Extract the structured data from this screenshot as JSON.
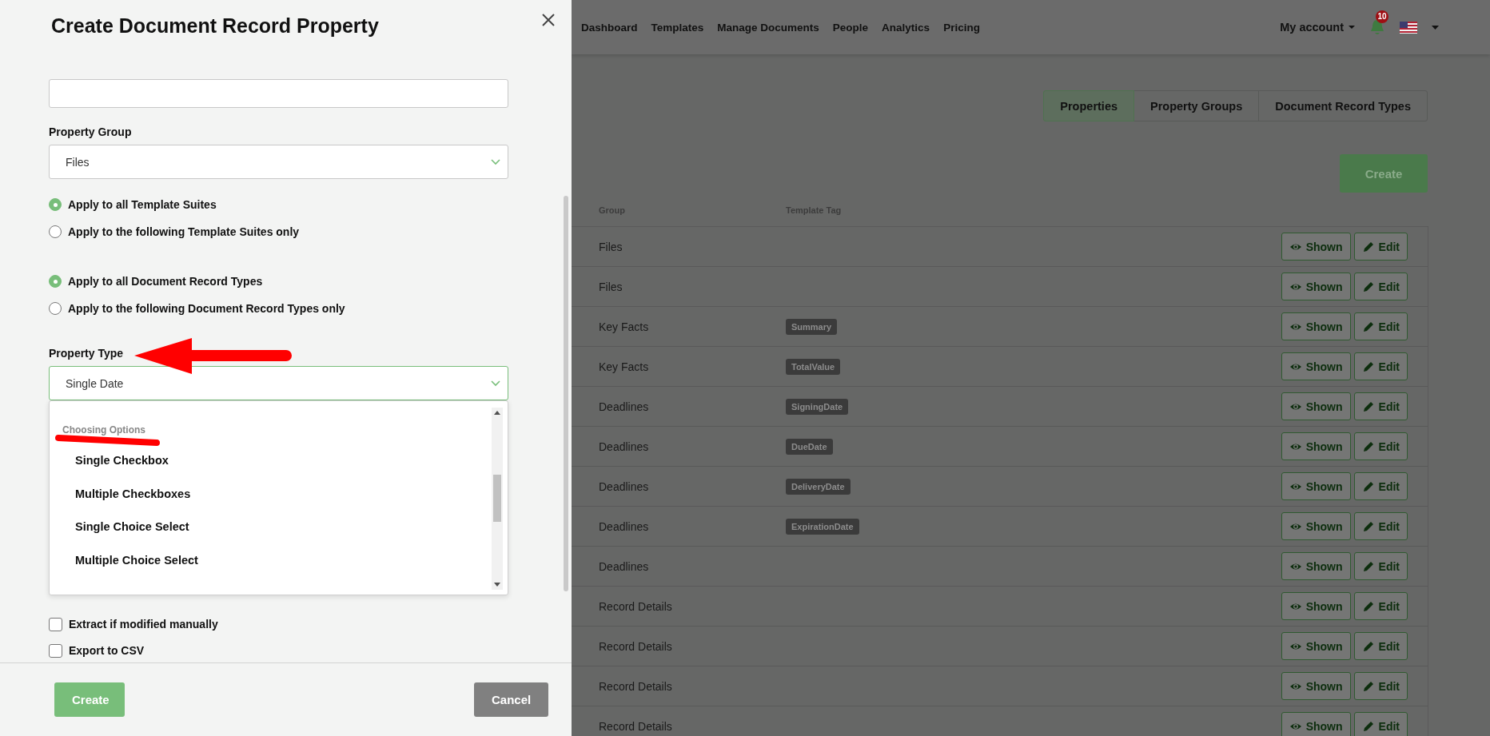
{
  "modal": {
    "title": "Create Document Record Property",
    "sections": [
      {
        "kind": "text"
      },
      {
        "kind": "select",
        "label": "Property Group",
        "value": "Files",
        "focused": false
      },
      {
        "kind": "radios",
        "options": [
          {
            "label": "Apply to all Template Suites",
            "selected": true
          },
          {
            "label": "Apply to the following Template Suites only",
            "selected": false
          }
        ]
      },
      {
        "kind": "radios",
        "options": [
          {
            "label": "Apply to all Document Record Types",
            "selected": true
          },
          {
            "label": "Apply to the following Document Record Types only",
            "selected": false
          }
        ]
      },
      {
        "kind": "select",
        "label": "Property Type",
        "value": "Single Date",
        "focused": true,
        "annotation": {
          "kind": "arrow"
        }
      }
    ],
    "dropdown": {
      "heading": "Choosing Options",
      "annotation": {
        "kind": "underline"
      },
      "options": [
        "Single Checkbox",
        "Multiple Checkboxes",
        "Single Choice Select",
        "Multiple Choice Select"
      ]
    },
    "checkboxes": [
      {
        "label": "Extract if modified manually",
        "checked": false
      },
      {
        "label": "Export to CSV",
        "checked": false
      }
    ],
    "buttons": [
      {
        "kind": "primary",
        "label": "Create"
      },
      {
        "kind": "secondary",
        "label": "Cancel"
      }
    ]
  },
  "page": {
    "nav": {
      "items": [
        "Dashboard",
        "Templates",
        "Manage Documents",
        "People",
        "Analytics",
        "Pricing"
      ],
      "account": "My account",
      "notifications": "10"
    },
    "tabs": [
      {
        "label": "Properties",
        "selected": true
      },
      {
        "label": "Property Groups",
        "selected": false
      },
      {
        "label": "Document Record Types",
        "selected": false
      }
    ],
    "create_button": "Create",
    "table": {
      "columns": [
        "Group",
        "Template Tag"
      ],
      "rows": [
        {
          "group": "Files",
          "shown": "Shown",
          "edit": "Edit"
        },
        {
          "group": "Files",
          "shown": "Shown",
          "edit": "Edit"
        },
        {
          "group": "Key Facts",
          "tag": "Summary",
          "shown": "Shown",
          "edit": "Edit"
        },
        {
          "group": "Key Facts",
          "tag": "TotalValue",
          "shown": "Shown",
          "edit": "Edit"
        },
        {
          "group": "Deadlines",
          "tag": "SigningDate",
          "shown": "Shown",
          "edit": "Edit"
        },
        {
          "group": "Deadlines",
          "tag": "DueDate",
          "shown": "Shown",
          "edit": "Edit"
        },
        {
          "group": "Deadlines",
          "tag": "DeliveryDate",
          "shown": "Shown",
          "edit": "Edit"
        },
        {
          "group": "Deadlines",
          "tag": "ExpirationDate",
          "shown": "Shown",
          "edit": "Edit"
        },
        {
          "group": "Deadlines",
          "shown": "Shown",
          "edit": "Edit"
        },
        {
          "group": "Record Details",
          "shown": "Shown",
          "edit": "Edit"
        },
        {
          "group": "Record Details",
          "shown": "Shown",
          "edit": "Edit"
        },
        {
          "group": "Record Details",
          "shown": "Shown",
          "edit": "Edit"
        },
        {
          "group": "Record Details",
          "shown": "Shown",
          "edit": "Edit"
        }
      ]
    }
  }
}
